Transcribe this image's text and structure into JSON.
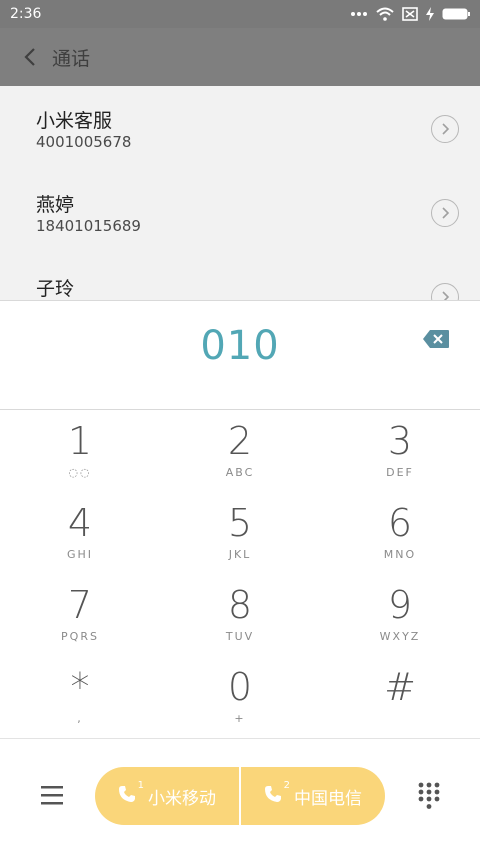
{
  "status_bar": {
    "time": "2:36"
  },
  "toolbar": {
    "title": "通话"
  },
  "contacts": [
    {
      "name": "小米客服",
      "number": "4001005678"
    },
    {
      "name": "燕婷",
      "number": "18401015689"
    },
    {
      "name": "子玲",
      "number": ""
    }
  ],
  "dialer": {
    "number": "010"
  },
  "keys": [
    {
      "digit": "1",
      "letters": "◌◌"
    },
    {
      "digit": "2",
      "letters": "ABC"
    },
    {
      "digit": "3",
      "letters": "DEF"
    },
    {
      "digit": "4",
      "letters": "GHI"
    },
    {
      "digit": "5",
      "letters": "JKL"
    },
    {
      "digit": "6",
      "letters": "MNO"
    },
    {
      "digit": "7",
      "letters": "PQRS"
    },
    {
      "digit": "8",
      "letters": "TUV"
    },
    {
      "digit": "9",
      "letters": "WXYZ"
    },
    {
      "digit": "*",
      "letters": ","
    },
    {
      "digit": "0",
      "letters": "+"
    },
    {
      "digit": "#",
      "letters": ""
    }
  ],
  "call_buttons": [
    {
      "label": "小米移动",
      "sim": "1"
    },
    {
      "label": "中国电信",
      "sim": "2"
    }
  ],
  "colors": {
    "accent": "#52a7b5",
    "call": "#fad67a",
    "header": "#7f7f7f"
  }
}
